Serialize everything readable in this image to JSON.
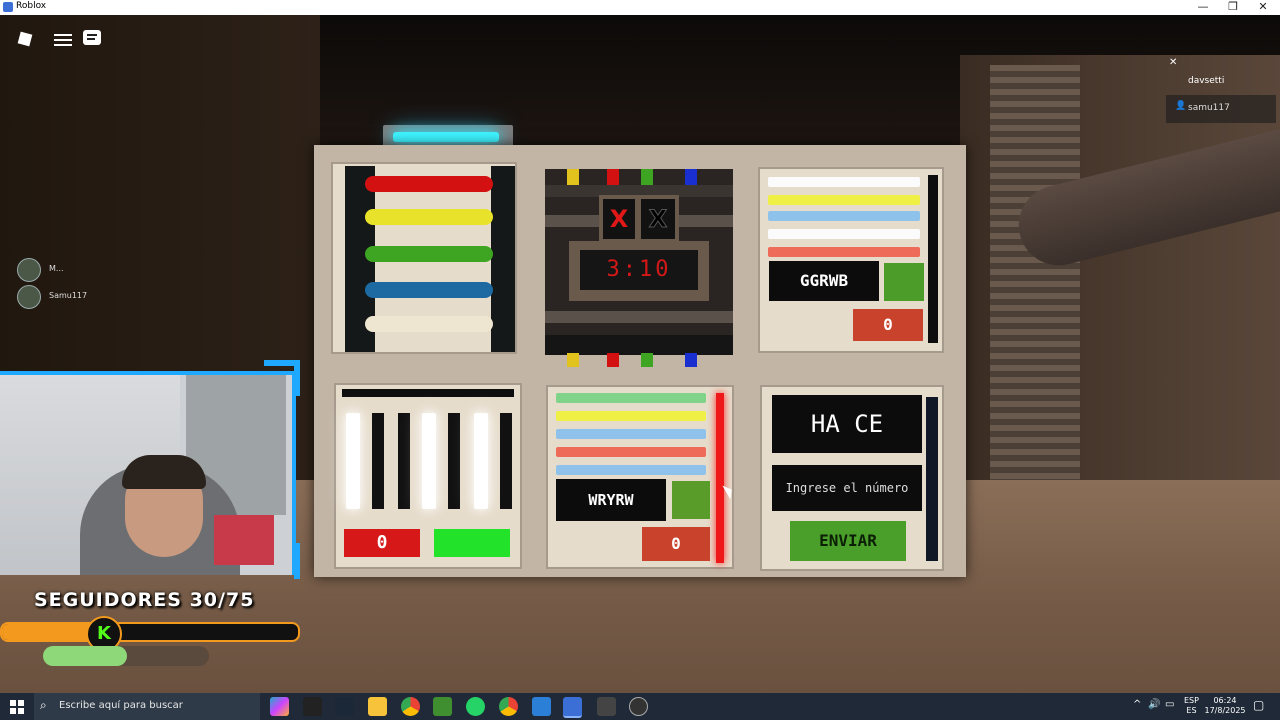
{
  "window": {
    "title": "Roblox",
    "minimize": "—",
    "restore": "❐",
    "close": "✕"
  },
  "roblox_menu": {
    "players_panel": {
      "close": "✕",
      "player1": "davsetti",
      "player2": "samu117"
    }
  },
  "side_players": [
    "M...",
    "Samu117"
  ],
  "puzzle": {
    "bomb": {
      "strike1": "X",
      "strike2": "X",
      "timer": "3:10"
    },
    "top_right": {
      "code": "GGRWB",
      "counter": "0"
    },
    "bottom_left": {
      "counter": "0"
    },
    "bottom_middle": {
      "code": "WRYRW",
      "counter": "0"
    },
    "bottom_right": {
      "display": "HA CE",
      "input_placeholder": "Ingrese el número",
      "submit": "ENVIAR"
    }
  },
  "overlay": {
    "followers": "SEGUIDORES 30/75",
    "progress": 0.36,
    "badge": "K"
  },
  "taskbar": {
    "search_placeholder": "Escribe aquí para buscar",
    "lang1": "ESP",
    "lang2": "ES",
    "time": "06:24",
    "date": "17/8/2025"
  },
  "colors": {
    "wire_red": "#d41111",
    "wire_yellow": "#e8e32a",
    "wire_green": "#3da521",
    "wire_blue": "#1d6aa3",
    "wire_white": "#efe6d1",
    "accent": "#2aa7ff"
  }
}
